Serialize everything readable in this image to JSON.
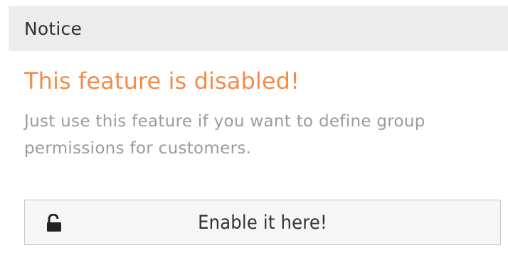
{
  "notice": {
    "header_title": "Notice",
    "title": "This feature is disabled!",
    "description": "Just use this feature if you want to define group permissions for customers.",
    "button_label": "Enable it here!",
    "button_icon": "unlock-icon"
  },
  "colors": {
    "accent": "#f58b49",
    "header_bg": "#ececec",
    "muted_text": "#9b9b9b"
  }
}
